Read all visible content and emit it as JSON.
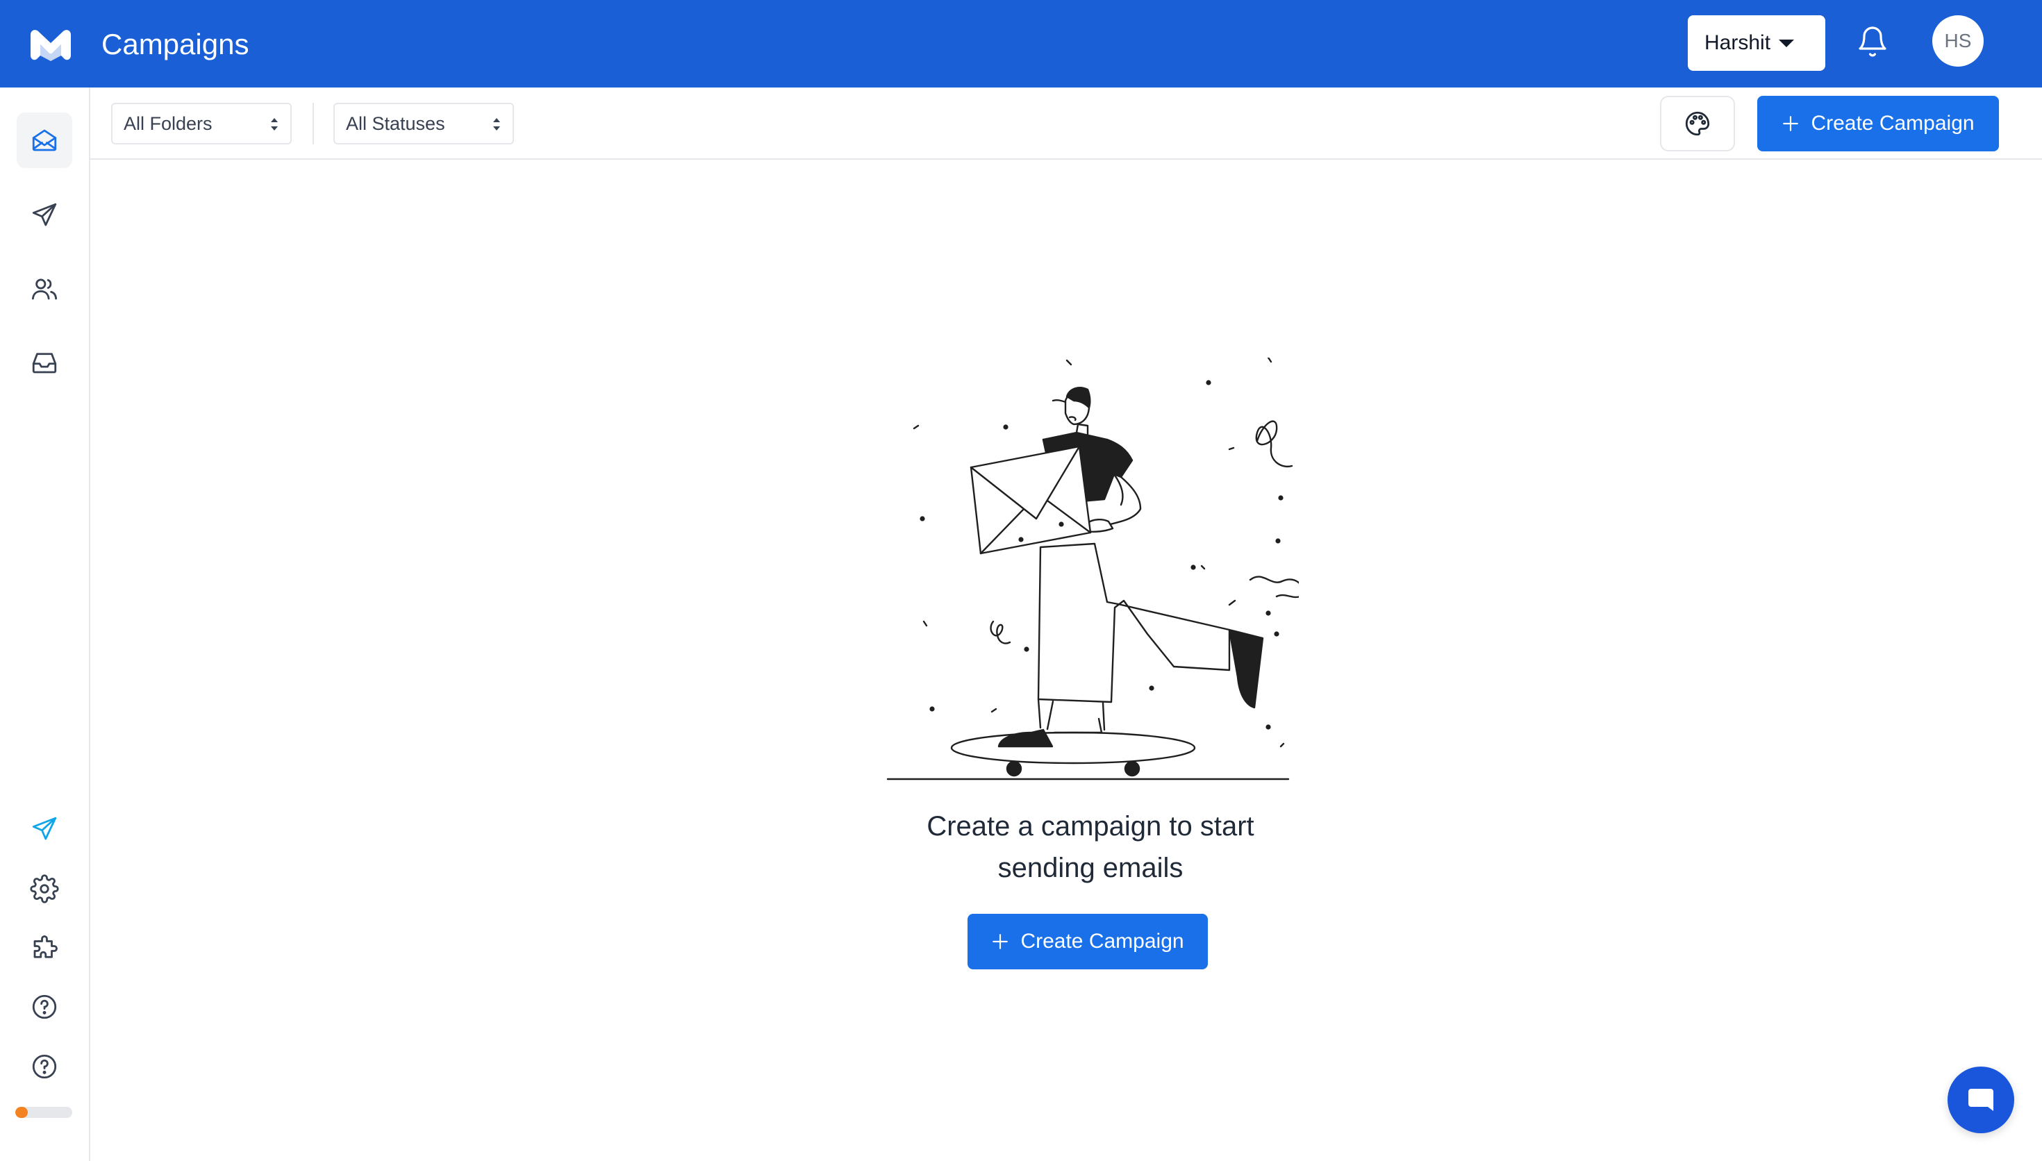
{
  "header": {
    "title": "Campaigns",
    "workspace": "Harshit",
    "avatar_initials": "HS",
    "brand_color": "#1a5fd6"
  },
  "sidebar": {
    "items": [
      {
        "name": "campaigns",
        "icon": "mail-open-icon",
        "active": true
      },
      {
        "name": "send",
        "icon": "paper-plane-icon",
        "active": false
      },
      {
        "name": "contacts",
        "icon": "users-icon",
        "active": false
      },
      {
        "name": "inbox",
        "icon": "inbox-icon",
        "active": false
      }
    ],
    "bottom_items": [
      {
        "name": "send-highlight",
        "icon": "paper-plane-icon"
      },
      {
        "name": "settings",
        "icon": "gear-icon"
      },
      {
        "name": "integrations",
        "icon": "puzzle-icon"
      },
      {
        "name": "help",
        "icon": "question-circle-icon"
      },
      {
        "name": "support",
        "icon": "question-circle-icon"
      }
    ],
    "progress_fraction": 0.22,
    "progress_color": "#f58220"
  },
  "toolbar": {
    "folder_filter": "All Folders",
    "status_filter": "All Statuses",
    "create_label": "Create Campaign",
    "accent_color": "#1970e8"
  },
  "empty_state": {
    "message": "Create a campaign to start sending emails",
    "create_label": "Create Campaign"
  }
}
